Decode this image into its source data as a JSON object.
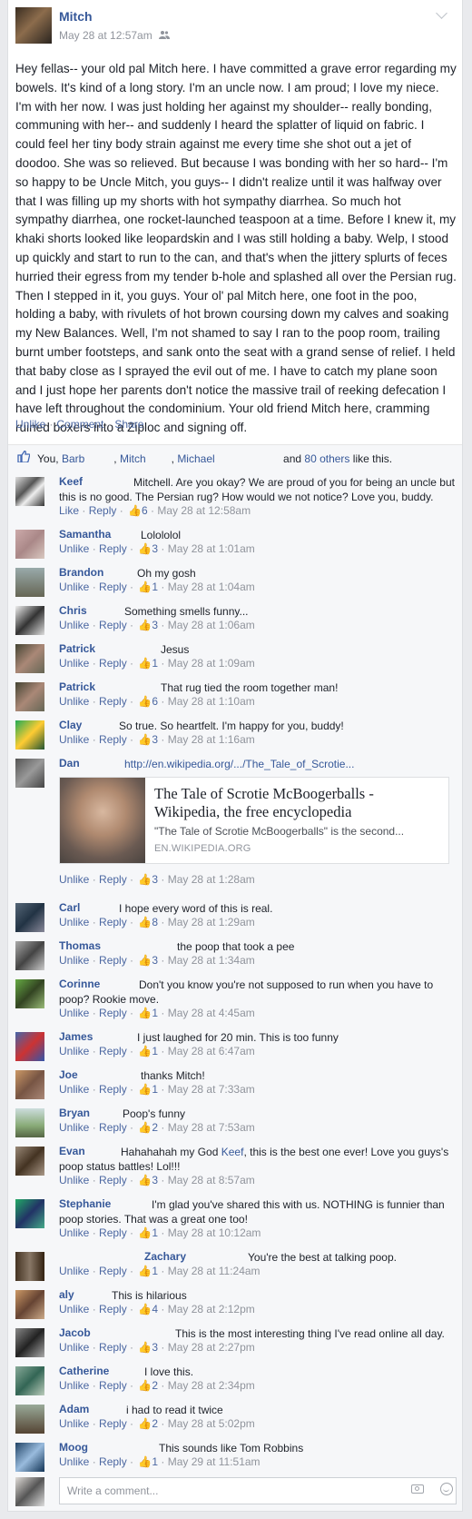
{
  "post": {
    "author": "Mitch",
    "timestamp": "May 28 at 12:57am",
    "audience_icon": "friends-icon",
    "body": "Hey fellas-- your old pal Mitch here. I have committed a grave error regarding my bowels. It's kind of a long story. I'm an uncle now. I am proud; I love my niece. I'm with her now. I was just holding her against my shoulder-- really bonding, communing with her-- and suddenly I heard the splatter of liquid on fabric. I could feel her tiny body strain against me every time she shot out a jet of doodoo. She was so relieved. But because I was bonding with her so hard-- I'm so happy to be Uncle Mitch, you guys-- I didn't realize until it was halfway over that I was filling up my shorts with hot sympathy diarrhea. So much hot sympathy diarrhea, one rocket-launched teaspoon at a time. Before I knew it, my khaki shorts looked like leopardskin and I was still holding a baby. Welp, I stood up quickly and start to run to the can, and that's when the jittery splurts of feces hurried their egress from my tender b-hole and splashed all over the Persian rug. Then I stepped in it, you guys. Your ol' pal Mitch here, one foot in the poo, holding a baby, with rivulets of hot brown coursing down my calves and soaking my New Balances. Well, I'm not shamed to say I ran to the poop room, trailing burnt umber footsteps, and sank onto the seat with a grand sense of relief. I held that baby close as I sprayed the evil out of me. I have to catch my plane soon and I just hope her parents don't notice the massive trail of reeking defecation I have left throughout the condominium. Your old friend Mitch here, cramming ruined boxers into a Ziploc and signing off.",
    "actions": {
      "unlike": "Unlike",
      "comment": "Comment",
      "share": "Share"
    }
  },
  "likes": {
    "you": "You,",
    "name1": "Barb",
    "name2": "Mitch",
    "name3": "Michael",
    "and": "and",
    "others": "80 others",
    "suffix": "like this."
  },
  "comments": [
    {
      "name": "Keef",
      "text": "Mitchell. Are you okay? We are proud of you for being an uncle but this is no good. The Persian rug? How would we not notice? Love you, buddy.",
      "action": "Like",
      "reply": "Reply",
      "likes": "6",
      "time": "May 28 at 12:58am"
    },
    {
      "name": "Samantha",
      "text": "Lolololol",
      "action": "Unlike",
      "reply": "Reply",
      "likes": "3",
      "time": "May 28 at 1:01am"
    },
    {
      "name": "Brandon",
      "text": "Oh my gosh",
      "action": "Unlike",
      "reply": "Reply",
      "likes": "1",
      "time": "May 28 at 1:04am"
    },
    {
      "name": "Chris",
      "text": "Something smells funny...",
      "action": "Unlike",
      "reply": "Reply",
      "likes": "3",
      "time": "May 28 at 1:06am"
    },
    {
      "name": "Patrick",
      "text": "Jesus",
      "action": "Unlike",
      "reply": "Reply",
      "likes": "1",
      "time": "May 28 at 1:09am"
    },
    {
      "name": "Patrick",
      "text": "That rug tied the room together man!",
      "action": "Unlike",
      "reply": "Reply",
      "likes": "6",
      "time": "May 28 at 1:10am"
    },
    {
      "name": "Clay",
      "text": "So true. So heartfelt. I'm happy for you, buddy!",
      "action": "Unlike",
      "reply": "Reply",
      "likes": "3",
      "time": "May 28 at 1:16am"
    },
    {
      "name": "Dan",
      "text": "http://en.wikipedia.org/.../The_Tale_of_Scrotie...",
      "action": "Unlike",
      "reply": "Reply",
      "likes": "3",
      "time": "May 28 at 1:28am",
      "link": {
        "title": "The Tale of Scrotie McBoogerballs - Wikipedia, the free encyclopedia",
        "desc": "\"The Tale of Scrotie McBoogerballs\" is the second...",
        "domain": "EN.WIKIPEDIA.ORG"
      }
    },
    {
      "name": "Carl",
      "text": "I hope every word of this is real.",
      "action": "Unlike",
      "reply": "Reply",
      "likes": "8",
      "time": "May 28 at 1:29am"
    },
    {
      "name": "Thomas",
      "text": "the poop that took a pee",
      "action": "Unlike",
      "reply": "Reply",
      "likes": "3",
      "time": "May 28 at 1:34am"
    },
    {
      "name": "Corinne",
      "text": "Don't you know you're not supposed to run when you have to poop? Rookie move.",
      "action": "Unlike",
      "reply": "Reply",
      "likes": "1",
      "time": "May 28 at 4:45am"
    },
    {
      "name": "James",
      "text": "I just laughed for 20 min. This is too funny",
      "action": "Unlike",
      "reply": "Reply",
      "likes": "1",
      "time": "May 28 at 6:47am"
    },
    {
      "name": "Joe",
      "text": "thanks Mitch!",
      "action": "Unlike",
      "reply": "Reply",
      "likes": "1",
      "time": "May 28 at 7:33am"
    },
    {
      "name": "Bryan",
      "text": "Poop's funny",
      "action": "Unlike",
      "reply": "Reply",
      "likes": "2",
      "time": "May 28 at 7:53am"
    },
    {
      "name": "Evan",
      "text_pre": "Hahahahah my God ",
      "mention": "Keef",
      "text_post": ", this is the best one ever! Love you guys's poop status battles! Lol!!!",
      "action": "Unlike",
      "reply": "Reply",
      "likes": "3",
      "time": "May 28 at 8:57am"
    },
    {
      "name": "Stephanie",
      "text": "I'm glad you've shared this with us. NOTHING is funnier than poop stories. That was a great one too!",
      "action": "Unlike",
      "reply": "Reply",
      "likes": "1",
      "time": "May 28 at 10:12am"
    },
    {
      "name": "Zachary",
      "text": "You're the best at talking poop.",
      "action": "Unlike",
      "reply": "Reply",
      "likes": "1",
      "time": "May 28 at 11:24am"
    },
    {
      "name": "aly",
      "text": "This is hilarious",
      "action": "Unlike",
      "reply": "Reply",
      "likes": "4",
      "time": "May 28 at 2:12pm"
    },
    {
      "name": "Jacob",
      "text": "This is the most interesting thing I've read online all day.",
      "action": "Unlike",
      "reply": "Reply",
      "likes": "3",
      "time": "May 28 at 2:27pm"
    },
    {
      "name": "Catherine",
      "text": "I love this.",
      "action": "Unlike",
      "reply": "Reply",
      "likes": "2",
      "time": "May 28 at 2:34pm"
    },
    {
      "name": "Adam",
      "text": "i had to read it twice",
      "action": "Unlike",
      "reply": "Reply",
      "likes": "2",
      "time": "May 28 at 5:02pm"
    },
    {
      "name": "Moog",
      "text": "This sounds like Tom Robbins",
      "action": "Unlike",
      "reply": "Reply",
      "likes": "1",
      "time": "May 29 at 11:51am"
    }
  ],
  "composer": {
    "placeholder": "Write a comment..."
  },
  "colors": {
    "link": "#365899",
    "meta": "#90949c",
    "like_blue": "#4267b2",
    "panel": "#f6f7f9"
  }
}
